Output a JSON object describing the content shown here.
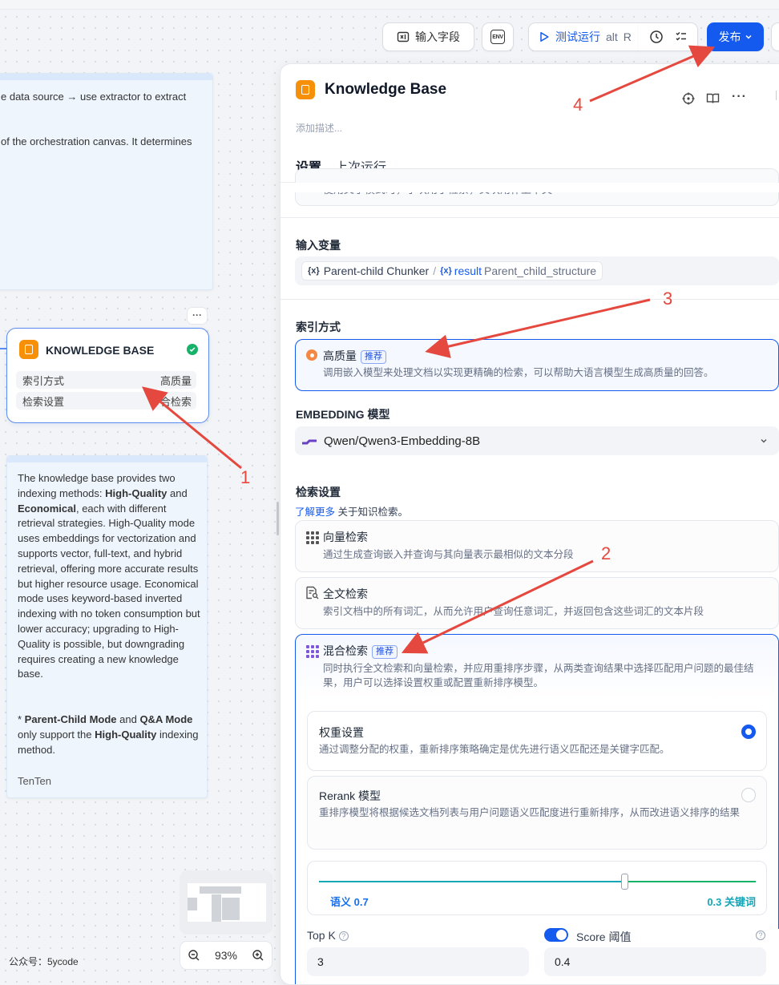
{
  "toolbar": {
    "input_fields": "输入字段",
    "env": "ENV",
    "test_run": "测试运行",
    "test_run_shortcut_1": "alt",
    "test_run_shortcut_2": "R",
    "publish": "发布"
  },
  "notes": {
    "top_line1": "e data source → use extractor to extract",
    "top_line2": "of the orchestration canvas. It determines",
    "main_paragraph": [
      {
        "t": "The knowledge base provides two indexing methods: "
      },
      {
        "t": "High-Quality",
        "b": true
      },
      {
        "t": " and "
      },
      {
        "t": "Economical",
        "b": true
      },
      {
        "t": ", each with different retrieval strategies. High-Quality mode uses embeddings for vectorization and supports vector, full-text, and hybrid retrieval, offering more accurate results but higher resource usage. Economical mode uses keyword-based inverted indexing with no token consumption but lower accuracy; upgrading to High-Quality is possible, but downgrading requires creating a new knowledge base."
      }
    ],
    "second_paragraph": [
      {
        "t": "* "
      },
      {
        "t": "Parent-Child Mode",
        "b": true
      },
      {
        "t": " and "
      },
      {
        "t": "Q&A Mode",
        "b": true
      },
      {
        "t": " only support the "
      },
      {
        "t": "High-Quality",
        "b": true
      },
      {
        "t": " indexing method."
      }
    ],
    "author": "TenTen"
  },
  "kb_node": {
    "title": "KNOWLEDGE BASE",
    "more": "···",
    "rows": [
      {
        "label": "索引方式",
        "value": "高质量"
      },
      {
        "label": "检索设置",
        "value": "合检索"
      }
    ]
  },
  "canvas": {
    "zoom": "93%",
    "footer": "公众号：5ycode"
  },
  "panel": {
    "title": "Knowledge Base",
    "description_placeholder": "添加描述...",
    "tabs": [
      "设置",
      "上次运行"
    ],
    "top_card_text": "使用父子模式时，子块用于检索，父块用作上下文",
    "input_var": {
      "label": "输入变量",
      "node": "Parent-child Chunker",
      "sep": "/",
      "var_prefix": "result",
      "var_name": "Parent_child_structure"
    },
    "index_method": {
      "label": "索引方式",
      "option_title": "高质量",
      "tag": "推荐",
      "option_desc": "调用嵌入模型来处理文档以实现更精确的检索，可以帮助大语言模型生成高质量的回答。"
    },
    "embedding": {
      "label": "EMBEDDING 模型",
      "value": "Qwen/Qwen3-Embedding-8B"
    },
    "retrieval": {
      "label": "检索设置",
      "learn_more": "了解更多",
      "learn_more_suffix": "关于知识检索。",
      "vector": {
        "title": "向量检索",
        "desc": "通过生成查询嵌入并查询与其向量表示最相似的文本分段"
      },
      "fulltext": {
        "title": "全文检索",
        "desc": "索引文档中的所有词汇，从而允许用户查询任意词汇，并返回包含这些词汇的文本片段"
      },
      "hybrid": {
        "title": "混合检索",
        "tag": "推荐",
        "desc": "同时执行全文检索和向量检索，并应用重排序步骤，从两类查询结果中选择匹配用户问题的最佳结果，用户可以选择设置权重或配置重新排序模型。"
      },
      "weight": {
        "title": "权重设置",
        "desc": "通过调整分配的权重，重新排序策略确定是优先进行语义匹配还是关键字匹配。",
        "selected": true
      },
      "rerank": {
        "title": "Rerank 模型",
        "desc": "重排序模型将根据候选文档列表与用户问题语义匹配度进行重新排序，从而改进语义排序的结果",
        "selected": false
      },
      "slider": {
        "left_label": "语义 0.7",
        "right_label": "0.3 关键词",
        "semantic_weight": 0.7
      },
      "topk": {
        "label": "Top K",
        "value": "3"
      },
      "score": {
        "label": "Score 阈值",
        "value": "0.4",
        "enabled": true
      }
    }
  },
  "annotations": [
    "1",
    "2",
    "3",
    "4"
  ],
  "colors": {
    "primary": "#155aef",
    "arrow": "#e5483e",
    "accent_orange": "#f79009",
    "slider_teal": "#15a6b8"
  }
}
